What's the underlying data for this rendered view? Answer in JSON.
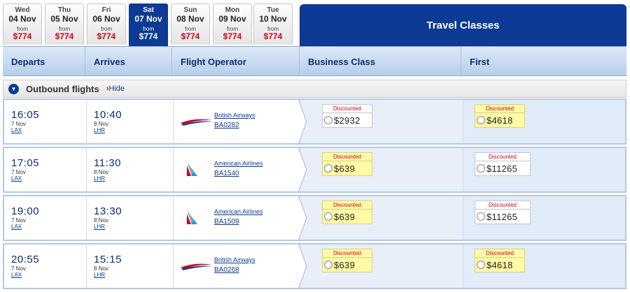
{
  "dates": [
    {
      "dow": "Wed",
      "date": "04 Nov",
      "from": "from",
      "price": "$774",
      "selected": false
    },
    {
      "dow": "Thu",
      "date": "05 Nov",
      "from": "from",
      "price": "$774",
      "selected": false
    },
    {
      "dow": "Fri",
      "date": "06 Nov",
      "from": "from",
      "price": "$774",
      "selected": false
    },
    {
      "dow": "Sat",
      "date": "07 Nov",
      "from": "from",
      "price": "$774",
      "selected": true
    },
    {
      "dow": "Sun",
      "date": "08 Nov",
      "from": "from",
      "price": "$774",
      "selected": false
    },
    {
      "dow": "Mon",
      "date": "09 Nov",
      "from": "from",
      "price": "$774",
      "selected": false
    },
    {
      "dow": "Tue",
      "date": "10 Nov",
      "from": "from",
      "price": "$774",
      "selected": false
    }
  ],
  "travel_classes": "Travel Classes",
  "columns": {
    "departs": "Departs",
    "arrives": "Arrives",
    "operator": "Flight Operator",
    "business": "Business Class",
    "first": "First"
  },
  "outbound": {
    "title": "Outbound flights",
    "hide": "Hide",
    "hide_chevron": "›"
  },
  "flights": [
    {
      "dep_time": "16:05",
      "dep_date": "7 Nov",
      "dep_airport": "LAX",
      "arr_time": "10:40",
      "arr_date": "8 Nov",
      "arr_airport": "LHR",
      "airline": "British Airways",
      "airline_logo": "british-airways-logo",
      "flight_no": "BA0282",
      "business": {
        "badge": "Discounted",
        "price": "$2932",
        "highlight": false
      },
      "first": {
        "badge": "Discounted",
        "price": "$4618",
        "highlight": true
      }
    },
    {
      "dep_time": "17:05",
      "dep_date": "7 Nov",
      "dep_airport": "LAX",
      "arr_time": "11:30",
      "arr_date": "8 Nov",
      "arr_airport": "LHR",
      "airline": "American Airlines",
      "airline_logo": "american-airlines-logo",
      "flight_no": "BA1540",
      "business": {
        "badge": "Discounted",
        "price": "$639",
        "highlight": true
      },
      "first": {
        "badge": "Discounted",
        "price": "$11265",
        "highlight": false
      }
    },
    {
      "dep_time": "19:00",
      "dep_date": "7 Nov",
      "dep_airport": "LAX",
      "arr_time": "13:30",
      "arr_date": "8 Nov",
      "arr_airport": "LHR",
      "airline": "American Airlines",
      "airline_logo": "american-airlines-logo",
      "flight_no": "BA1509",
      "business": {
        "badge": "Discounted",
        "price": "$639",
        "highlight": true
      },
      "first": {
        "badge": "Discounted",
        "price": "$11265",
        "highlight": false
      }
    },
    {
      "dep_time": "20:55",
      "dep_date": "7 Nov",
      "dep_airport": "LAX",
      "arr_time": "15:15",
      "arr_date": "8 Nov",
      "arr_airport": "LHR",
      "airline": "British Airways",
      "airline_logo": "british-airways-logo",
      "flight_no": "BA0268",
      "business": {
        "badge": "Discounted",
        "price": "$639",
        "highlight": true
      },
      "first": {
        "badge": "Discounted",
        "price": "$4618",
        "highlight": true
      }
    }
  ],
  "colors": {
    "brand_blue": "#0c3a94",
    "price_red": "#d0021b",
    "highlight_yellow": "#fffaa8"
  }
}
